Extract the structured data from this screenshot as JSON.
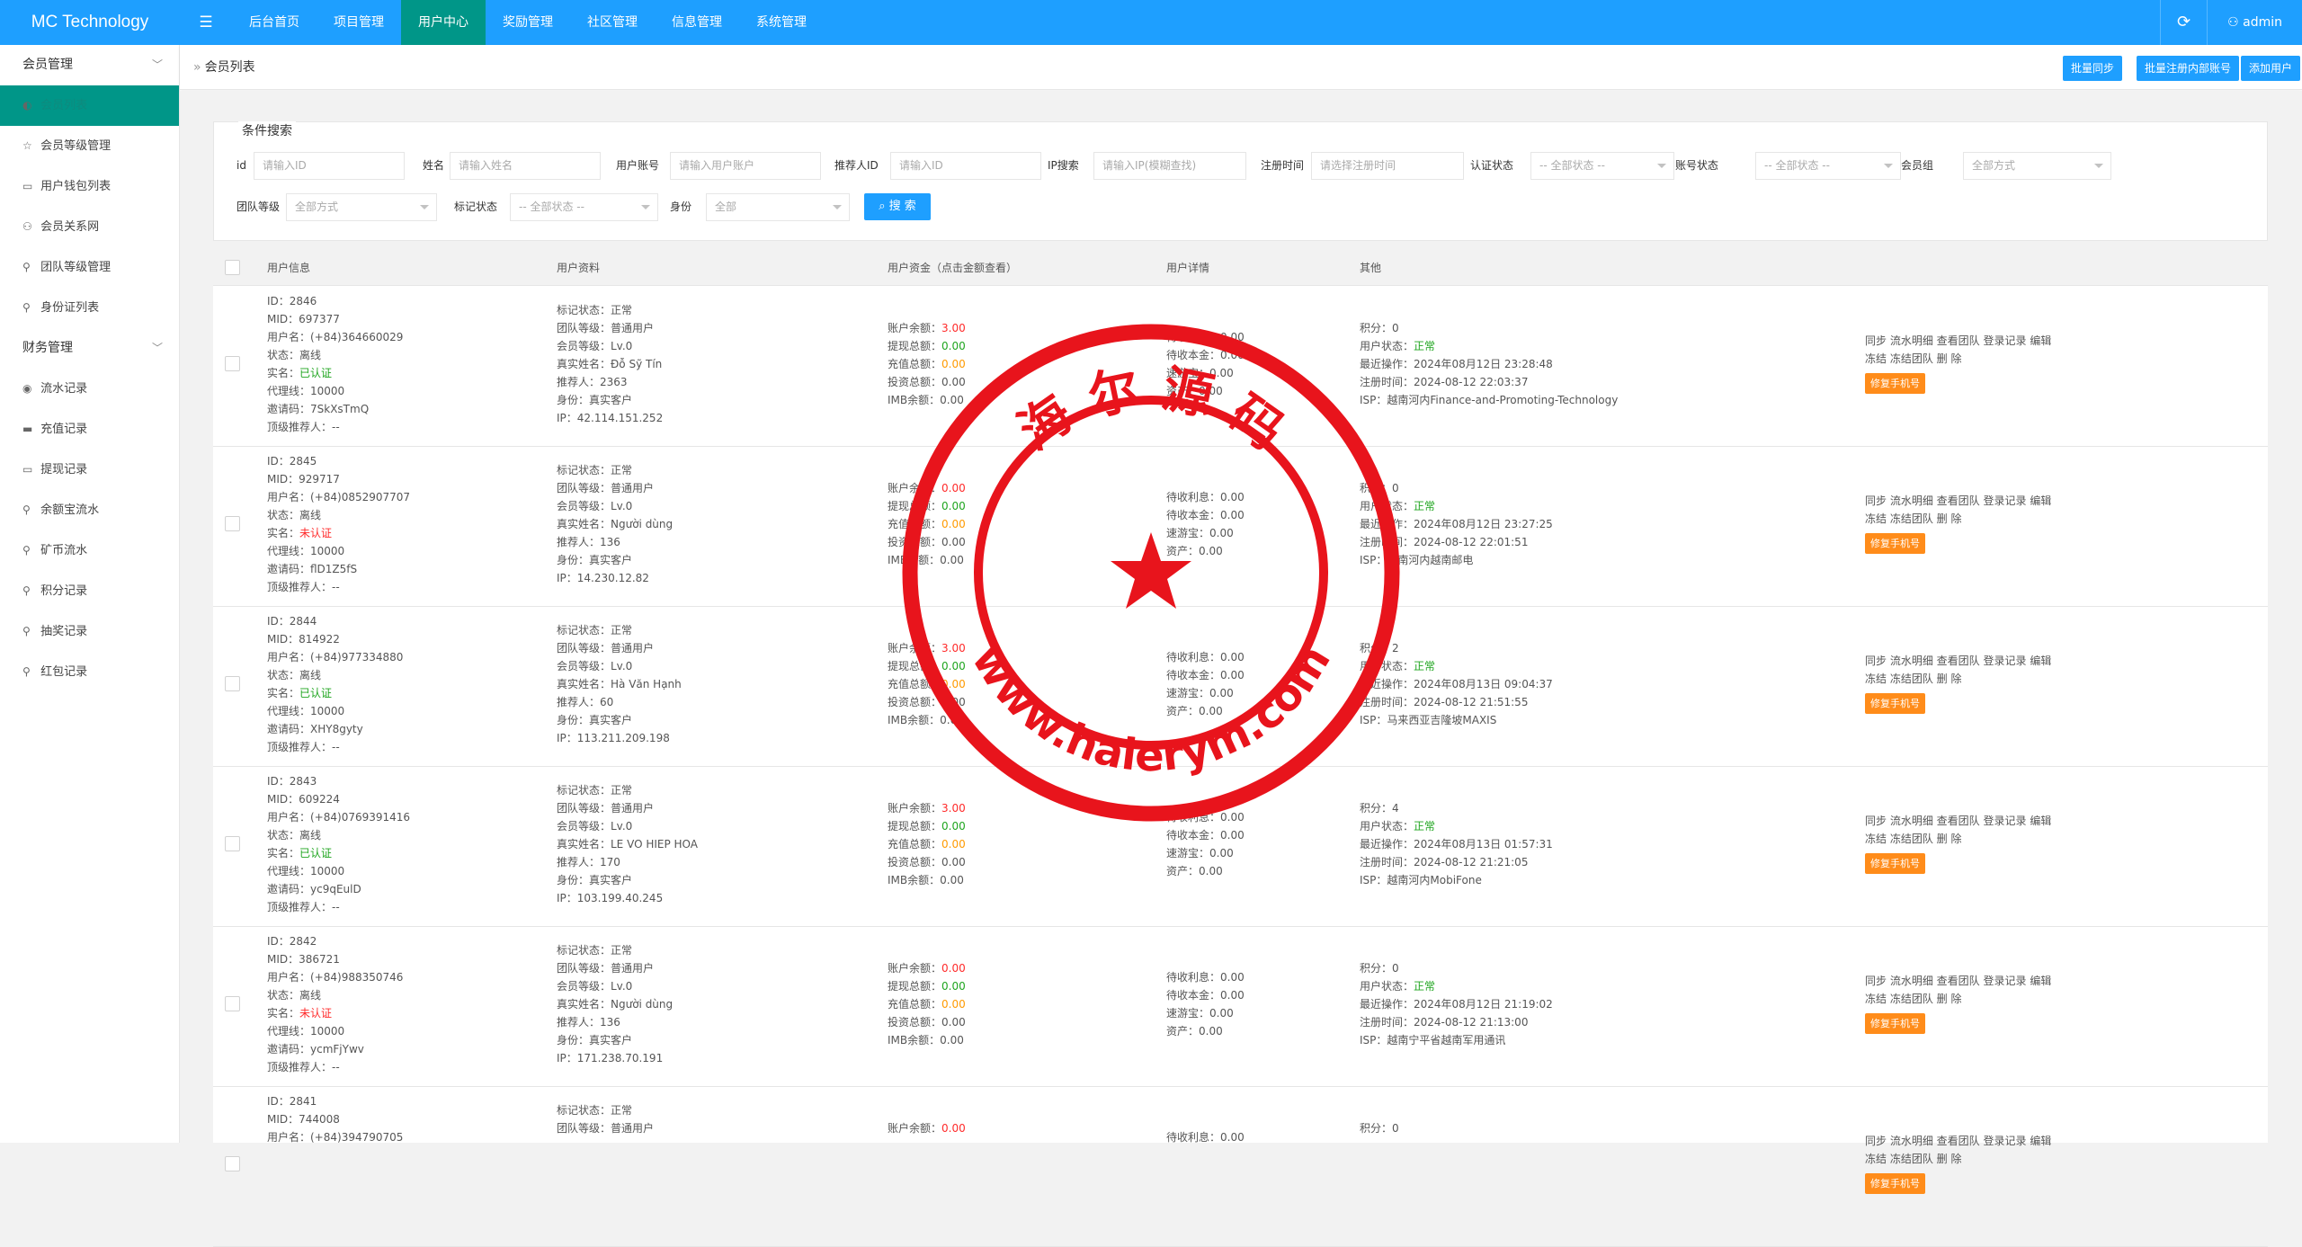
{
  "app": {
    "brand": "MC Technology",
    "admin": "admin"
  },
  "topnav": [
    "后台首页",
    "项目管理",
    "用户中心",
    "奖励管理",
    "社区管理",
    "信息管理",
    "系统管理"
  ],
  "sidebar": {
    "group1": "会员管理",
    "items1": [
      "会员列表",
      "会员等级管理",
      "用户钱包列表",
      "会员关系网",
      "团队等级管理",
      "身份证列表"
    ],
    "group2": "财务管理",
    "items2": [
      "流水记录",
      "充值记录",
      "提现记录",
      "余额宝流水",
      "矿币流水",
      "积分记录",
      "抽奖记录",
      "红包记录"
    ]
  },
  "breadcrumb": "会员列表",
  "buttons": {
    "sync": "批量同步",
    "batch_register": "批量注册内部账号",
    "add_user": "添加用户",
    "search": "搜 索"
  },
  "search": {
    "legend": "条件搜索",
    "fields": [
      {
        "label": "id",
        "placeholder": "请输入ID"
      },
      {
        "label": "姓名",
        "placeholder": "请输入姓名"
      },
      {
        "label": "用户账号",
        "placeholder": "请输入用户账户"
      },
      {
        "label": "推荐人ID",
        "placeholder": "请输入ID"
      },
      {
        "label": "IP搜索",
        "placeholder": "请输入IP(模糊查找)"
      },
      {
        "label": "注册时间",
        "placeholder": "请选择注册时间"
      },
      {
        "label": "认证状态",
        "placeholder": "-- 全部状态 --"
      },
      {
        "label": "账号状态",
        "placeholder": "-- 全部状态 --"
      },
      {
        "label": "会员组",
        "placeholder": "全部方式"
      },
      {
        "label": "团队等级",
        "placeholder": "全部方式"
      },
      {
        "label": "标记状态",
        "placeholder": "-- 全部状态 --"
      },
      {
        "label": "身份",
        "placeholder": "全部"
      }
    ]
  },
  "table": {
    "headers": [
      "用户信息",
      "用户资料",
      "用户资金（点击金额查看）",
      "用户详情",
      "其他"
    ],
    "rows": [
      {
        "info": [
          "ID：2846",
          "MID：697377",
          "用户名：(+84)364660029",
          "状态：",
          "离线",
          "实名：",
          "已认证",
          "代理线：10000",
          "邀请码：7SkXsTmQ",
          "顶级推荐人：--"
        ],
        "profile": [
          "标记状态：正常",
          "团队等级：普通用户",
          "会员等级：Lv.0",
          "真实姓名：Đỗ Sỹ Tín",
          "推荐人：2363",
          "身份：真实客户",
          "IP：42.114.151.252"
        ],
        "funds": [
          "3.00",
          "0.00",
          "0.00",
          "0.00",
          "0.00"
        ],
        "details": [
          "0.00",
          "0.00",
          "0.00",
          "0.00"
        ],
        "other": [
          "积分：0",
          "正常",
          "最近操作：2024年08月12日 23:28:48",
          "注册时间：2024-08-12 22:03:37",
          "ISP：越南河内Finance-and-Promoting-Technology"
        ]
      },
      {
        "info": [
          "ID：2845",
          "MID：929717",
          "用户名：(+84)0852907707",
          "状态：",
          "离线",
          "实名：",
          "未认证",
          "代理线：10000",
          "邀请码：flD1Z5fS",
          "顶级推荐人：--"
        ],
        "profile": [
          "标记状态：正常",
          "团队等级：普通用户",
          "会员等级：Lv.0",
          "真实姓名：Người dùng",
          "推荐人：136",
          "身份：真实客户",
          "IP：14.230.12.82"
        ],
        "funds": [
          "0.00",
          "0.00",
          "0.00",
          "0.00",
          "0.00"
        ],
        "details": [
          "0.00",
          "0.00",
          "0.00",
          "0.00"
        ],
        "other": [
          "积分：0",
          "正常",
          "最近操作：2024年08月12日 23:27:25",
          "注册时间：2024-08-12 22:01:51",
          "ISP：越南河内越南邮电"
        ]
      },
      {
        "info": [
          "ID：2844",
          "MID：814922",
          "用户名：(+84)977334880",
          "状态：",
          "离线",
          "实名：",
          "已认证",
          "代理线：10000",
          "邀请码：XHY8gyty",
          "顶级推荐人：--"
        ],
        "profile": [
          "标记状态：正常",
          "团队等级：普通用户",
          "会员等级：Lv.0",
          "真实姓名：Hà Văn Hạnh",
          "推荐人：60",
          "身份：真实客户",
          "IP：113.211.209.198"
        ],
        "funds": [
          "3.00",
          "0.00",
          "0.00",
          "0.00",
          "0.00"
        ],
        "details": [
          "0.00",
          "0.00",
          "0.00",
          "0.00"
        ],
        "other": [
          "积分：2",
          "正常",
          "最近操作：2024年08月13日 09:04:37",
          "注册时间：2024-08-12 21:51:55",
          "ISP：马来西亚吉隆坡MAXIS"
        ]
      },
      {
        "info": [
          "ID：2843",
          "MID：609224",
          "用户名：(+84)0769391416",
          "状态：",
          "离线",
          "实名：",
          "已认证",
          "代理线：10000",
          "邀请码：yc9qEulD",
          "顶级推荐人：--"
        ],
        "profile": [
          "标记状态：正常",
          "团队等级：普通用户",
          "会员等级：Lv.0",
          "真实姓名：LE VO HIEP HOA",
          "推荐人：170",
          "身份：真实客户",
          "IP：103.199.40.245"
        ],
        "funds": [
          "3.00",
          "0.00",
          "0.00",
          "0.00",
          "0.00"
        ],
        "details": [
          "0.00",
          "0.00",
          "0.00",
          "0.00"
        ],
        "other": [
          "积分：4",
          "正常",
          "最近操作：2024年08月13日 01:57:31",
          "注册时间：2024-08-12 21:21:05",
          "ISP：越南河内MobiFone"
        ]
      },
      {
        "info": [
          "ID：2842",
          "MID：386721",
          "用户名：(+84)988350746",
          "状态：",
          "离线",
          "实名：",
          "未认证",
          "代理线：10000",
          "邀请码：ycmFjYwv",
          "顶级推荐人：--"
        ],
        "profile": [
          "标记状态：正常",
          "团队等级：普通用户",
          "会员等级：Lv.0",
          "真实姓名：Người dùng",
          "推荐人：136",
          "身份：真实客户",
          "IP：171.238.70.191"
        ],
        "funds": [
          "0.00",
          "0.00",
          "0.00",
          "0.00",
          "0.00"
        ],
        "details": [
          "0.00",
          "0.00",
          "0.00",
          "0.00"
        ],
        "other": [
          "积分：0",
          "正常",
          "最近操作：2024年08月12日 21:19:02",
          "注册时间：2024-08-12 21:13:00",
          "ISP：越南宁平省越南军用通讯"
        ]
      },
      {
        "info": [
          "ID：2841",
          "MID：744008",
          "用户名：(+84)394790705"
        ],
        "profile": [
          "标记状态：正常",
          "团队等级：普通用户"
        ],
        "funds": [
          "0.00"
        ],
        "details": [
          "0.00"
        ],
        "other": [
          "积分：0"
        ]
      }
    ],
    "fund_labels": [
      "账户余额：",
      "提现总额：",
      "充值总额：",
      "投资总额：",
      "IMB余额："
    ],
    "detail_labels": [
      "待收利息：",
      "待收本金：",
      "速游宝：",
      "资产："
    ],
    "user_status_label": "用户状态：",
    "actions": [
      "同步",
      "流水明细",
      "查看团队",
      "登录记录",
      "编辑",
      "冻结",
      "冻结团队",
      "删 除"
    ],
    "fix_btn": "修复手机号"
  },
  "watermark": {
    "text_top": "海 尔 源 码",
    "text_bottom": "www.haierym.com",
    "color": "#e8141c"
  }
}
